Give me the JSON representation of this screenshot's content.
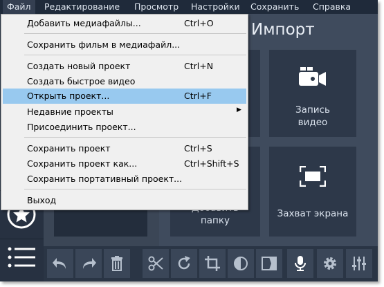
{
  "menubar": {
    "items": [
      "Файл",
      "Редактирование",
      "Просмотр",
      "Настройки",
      "Сохранить",
      "Справка"
    ]
  },
  "file_menu": {
    "items": [
      {
        "label": "Добавить медиафайлы...",
        "shortcut": "Ctrl+O"
      },
      {
        "label": "Сохранить фильм в медиафайл...",
        "shortcut": ""
      },
      {
        "label": "Создать новый проект",
        "shortcut": "Ctrl+N"
      },
      {
        "label": "Создать быстрое видео",
        "shortcut": ""
      },
      {
        "label": "Открыть проект...",
        "shortcut": "Ctrl+F",
        "highlighted": true
      },
      {
        "label": "Недавние проекты",
        "shortcut": "",
        "submenu": true
      },
      {
        "label": "Присоединить проект...",
        "shortcut": ""
      },
      {
        "label": "Сохранить проект",
        "shortcut": "Ctrl+S"
      },
      {
        "label": "Сохранить проект как...",
        "shortcut": "Ctrl+Shift+S"
      },
      {
        "label": "Сохранить портативный проект...",
        "shortcut": ""
      },
      {
        "label": "Выход",
        "shortcut": ""
      }
    ]
  },
  "import_panel": {
    "title": "Импорт",
    "tiles": {
      "record_video": "Запись видео",
      "add_folder": "Добавить папку",
      "screen_capture": "Захват экрана"
    }
  },
  "colors": {
    "menubar": "#1f2a3a",
    "panel": "#3f4b5d",
    "tile": "#2d3849",
    "highlight": "#98c9ef"
  }
}
